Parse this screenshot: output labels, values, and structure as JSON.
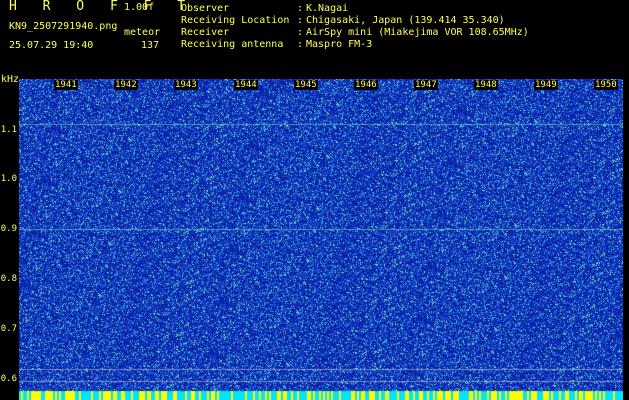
{
  "header": {
    "app_name": "H R O F F T",
    "version": "1.00f",
    "filename": "KN9_2507291940.png",
    "mode": "meteor",
    "datetime": "25.07.29 19:40",
    "count": "137"
  },
  "meta": [
    {
      "label": "Observer",
      "value": "K.Nagai"
    },
    {
      "label": "Receiving Location",
      "value": "Chigasaki, Japan (139.414 35.340)"
    },
    {
      "label": "Receiver",
      "value": "AirSpy mini (Miakejima VOR 108.65MHz)"
    },
    {
      "label": "Receiving antenna",
      "value": "Maspro FM-3"
    }
  ],
  "spectrogram": {
    "unit": "kHz",
    "y_ticks": [
      "1.1",
      "1.0",
      "0.9",
      "0.8",
      "0.7",
      "0.6"
    ],
    "x_ticks": [
      "1941",
      "1942",
      "1943",
      "1944",
      "1945",
      "1946",
      "1947",
      "1948",
      "1949",
      "1950"
    ],
    "colors": {
      "background": "#0c1fa8",
      "noise_low": "#1e6fe0",
      "noise_high": "#5ff0c0",
      "text": "#ffff5a",
      "bottom_band": "#ffff00"
    }
  }
}
